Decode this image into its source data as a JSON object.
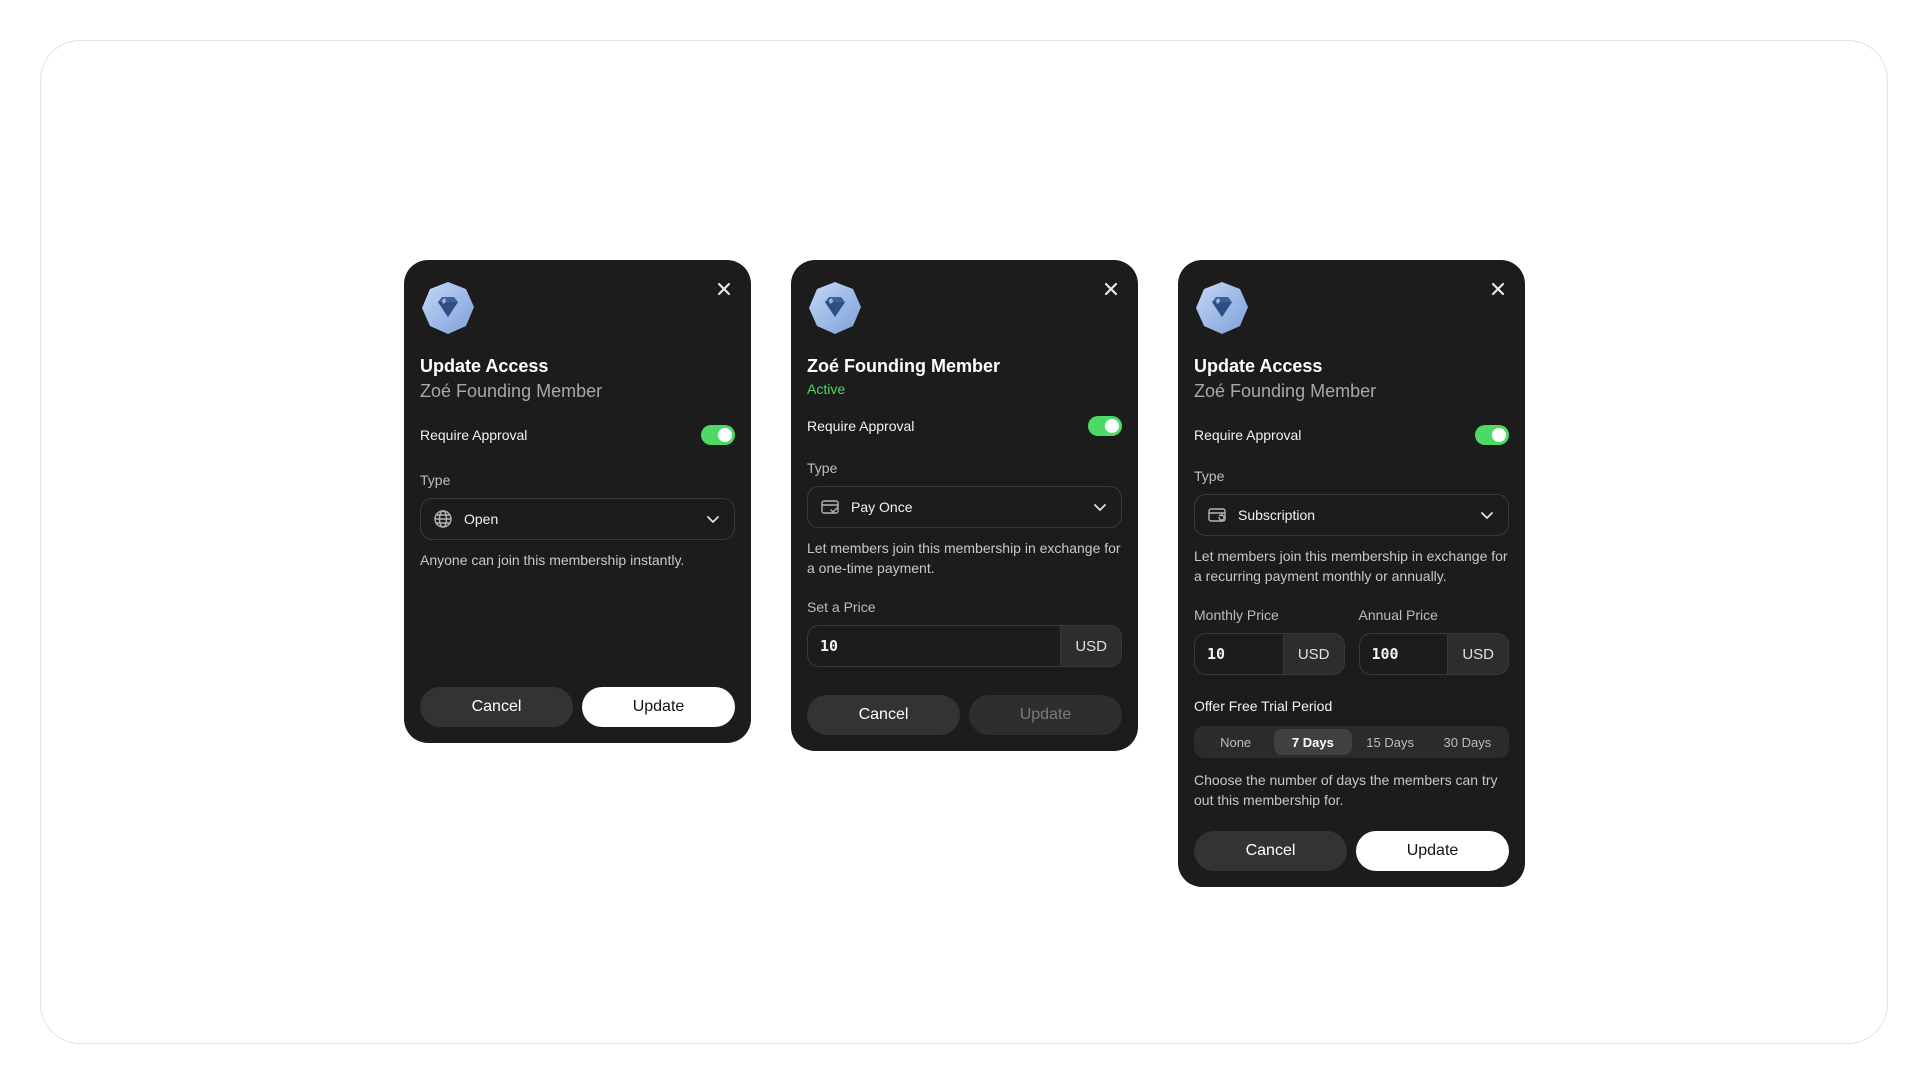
{
  "colors": {
    "modal_bg": "#1c1c1c",
    "toggle_on": "#4cd964",
    "status_active": "#4cd964",
    "badge_light": "#a9c4f1",
    "badge_dark": "#3d5f9c"
  },
  "modals": [
    {
      "title": "Update Access",
      "subtitle": "Zoé Founding Member",
      "require_approval_label": "Require Approval",
      "require_approval_on": true,
      "type_label": "Type",
      "type_value": "Open",
      "type_icon": "globe-icon",
      "description": "Anyone can join this membership instantly.",
      "cancel_label": "Cancel",
      "update_label": "Update"
    },
    {
      "title": "Zoé Founding Member",
      "status": "Active",
      "require_approval_label": "Require Approval",
      "require_approval_on": true,
      "type_label": "Type",
      "type_value": "Pay Once",
      "type_icon": "card-check-icon",
      "description": "Let members join this membership in exchange for a one-time payment.",
      "price_label": "Set a Price",
      "price_value": "10",
      "currency": "USD",
      "cancel_label": "Cancel",
      "update_label": "Update"
    },
    {
      "title": "Update Access",
      "subtitle": "Zoé Founding Member",
      "require_approval_label": "Require Approval",
      "require_approval_on": true,
      "type_label": "Type",
      "type_value": "Subscription",
      "type_icon": "card-refresh-icon",
      "description": "Let members join this membership in exchange for a recurring payment monthly or annually.",
      "monthly_label": "Monthly Price",
      "monthly_value": "10",
      "annual_label": "Annual Price",
      "annual_value": "100",
      "currency": "USD",
      "trial_label": "Offer Free Trial Period",
      "trial_options": [
        "None",
        "7 Days",
        "15 Days",
        "30 Days"
      ],
      "trial_selected": "7 Days",
      "trial_description": "Choose the number of days the members can try out this membership for.",
      "cancel_label": "Cancel",
      "update_label": "Update"
    }
  ]
}
